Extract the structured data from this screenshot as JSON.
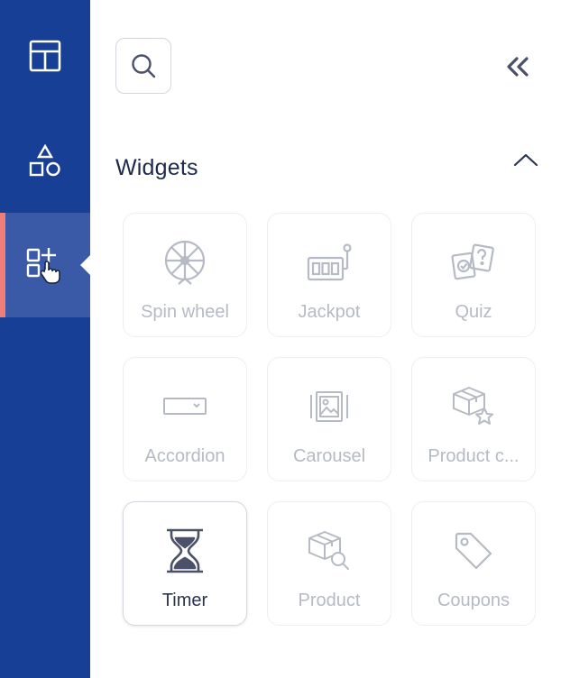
{
  "sidebar": {
    "items": [
      {
        "name": "layout",
        "icon": "layout-icon",
        "active": false
      },
      {
        "name": "elements",
        "icon": "shapes-icon",
        "active": false
      },
      {
        "name": "widgets",
        "icon": "add-widget-icon",
        "active": true
      }
    ],
    "colors": {
      "background": "#173f95",
      "active": "#3a5aa8",
      "indicator": "#ef7d7a"
    }
  },
  "panel": {
    "search_icon": "search-icon",
    "collapse_icon": "double-chevron-left-icon",
    "section": {
      "title": "Widgets",
      "toggle_icon": "chevron-up-icon"
    },
    "widgets": [
      {
        "label": "Spin wheel",
        "icon": "spin-wheel-icon",
        "enabled": false
      },
      {
        "label": "Jackpot",
        "icon": "jackpot-icon",
        "enabled": false
      },
      {
        "label": "Quiz",
        "icon": "quiz-icon",
        "enabled": false
      },
      {
        "label": "Accordion",
        "icon": "accordion-icon",
        "enabled": false
      },
      {
        "label": "Carousel",
        "icon": "carousel-icon",
        "enabled": false
      },
      {
        "label": "Product c...",
        "icon": "product-rating-icon",
        "enabled": false
      },
      {
        "label": "Timer",
        "icon": "hourglass-icon",
        "enabled": true
      },
      {
        "label": "Product",
        "icon": "product-search-icon",
        "enabled": false
      },
      {
        "label": "Coupons",
        "icon": "coupon-tag-icon",
        "enabled": false
      }
    ]
  }
}
